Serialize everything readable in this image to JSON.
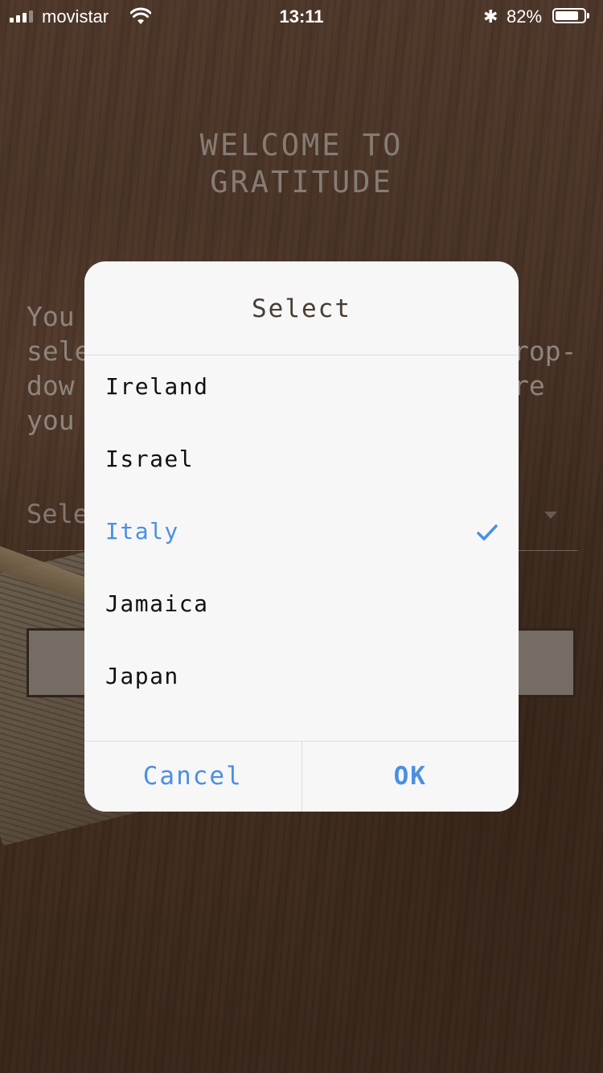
{
  "status_bar": {
    "carrier": "movistar",
    "time": "13:11",
    "battery_percent": "82%",
    "battery_level": 0.82
  },
  "screen": {
    "welcome_line1": "WELCOME TO",
    "welcome_line2": "GRATITUDE",
    "body_left": "You\nsele\ndow\nyou",
    "body_right": "rop-\nre",
    "select_placeholder": "Sele"
  },
  "dialog": {
    "title": "Select",
    "options": [
      {
        "label": "Ireland",
        "selected": false
      },
      {
        "label": "Israel",
        "selected": false
      },
      {
        "label": "Italy",
        "selected": true
      },
      {
        "label": "Jamaica",
        "selected": false
      },
      {
        "label": "Japan",
        "selected": false
      }
    ],
    "cancel_label": "Cancel",
    "ok_label": "OK",
    "accent_color": "#4a90e2"
  }
}
